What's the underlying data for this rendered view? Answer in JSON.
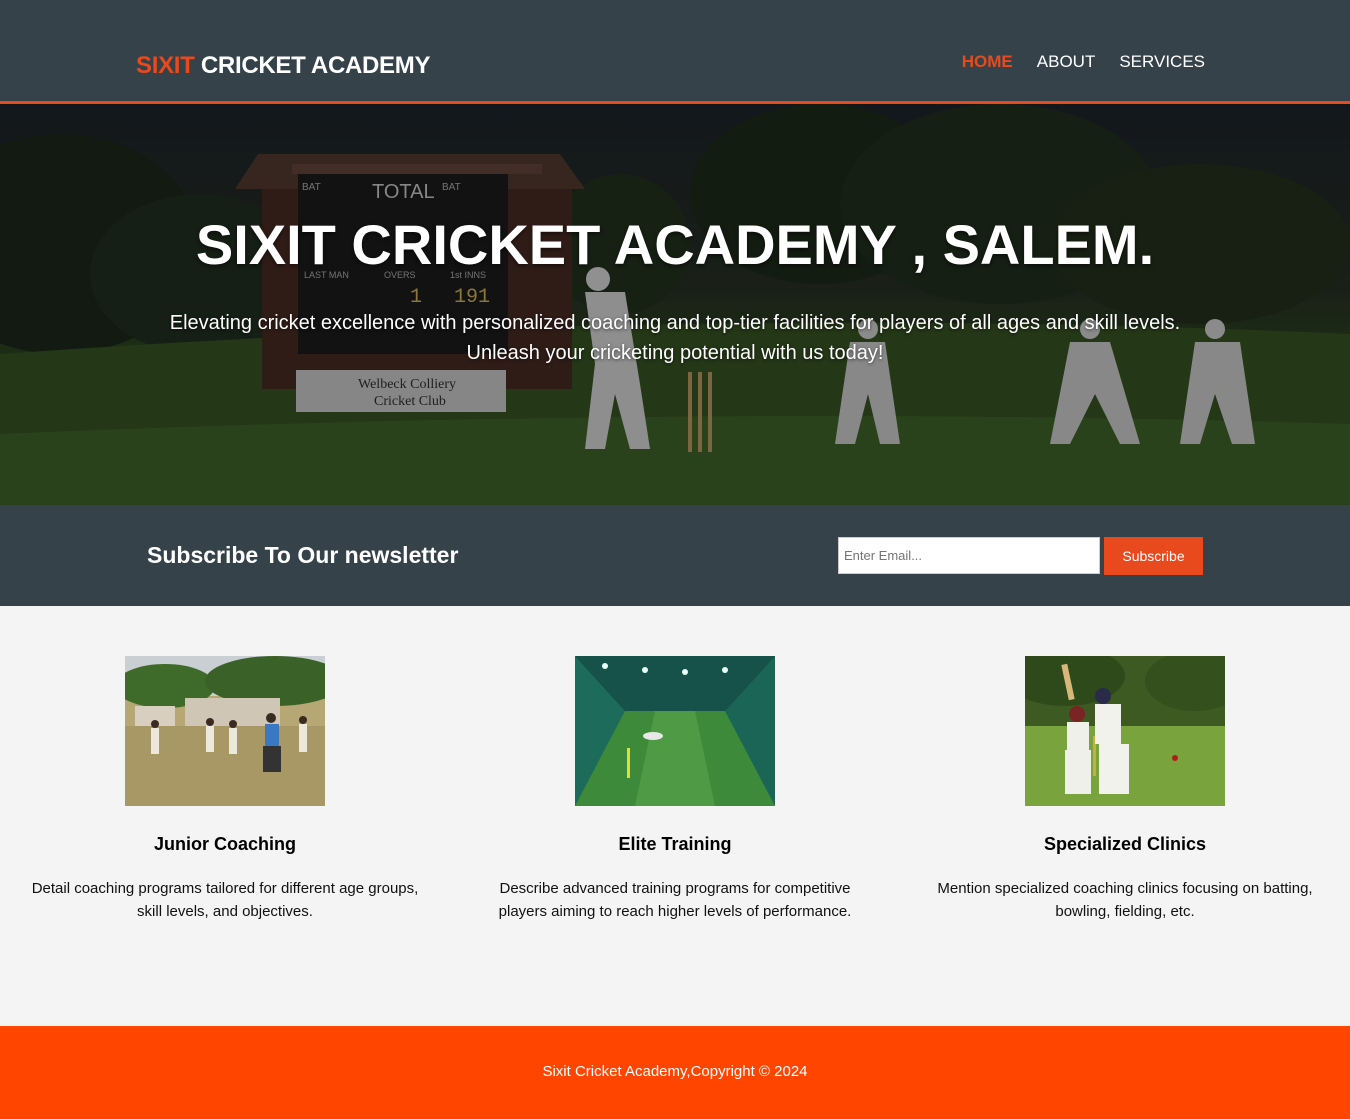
{
  "header": {
    "logo_highlight": "SIXIT",
    "logo_rest": " CRICKET ACADEMY",
    "nav": [
      {
        "label": "HOME",
        "active": true
      },
      {
        "label": "ABOUT",
        "active": false
      },
      {
        "label": "SERVICES",
        "active": false
      }
    ]
  },
  "hero": {
    "title": "SIXIT CRICKET ACADEMY , SALEM.",
    "text": "Elevating cricket excellence with personalized coaching and top-tier facilities for players of all ages and skill levels. Unleash your cricketing potential with us today!",
    "scene": {
      "scoreboard_total": "TOTAL",
      "scoreboard_small": [
        "BAT",
        "BAT",
        "LAST MAN",
        "OVERS",
        "1st INNS"
      ],
      "scoreboard_digits": [
        "1",
        "191"
      ],
      "sign_line1": "Welbeck Colliery",
      "sign_line2": "Cricket Club"
    }
  },
  "newsletter": {
    "title": "Subscribe To Our newsletter",
    "placeholder": "Enter Email...",
    "button": "Subscribe"
  },
  "boxes": [
    {
      "title": "Junior Coaching",
      "text": "Detail coaching programs tailored for different age groups, skill levels, and objectives."
    },
    {
      "title": "Elite Training",
      "text": "Describe advanced training programs for competitive players aiming to reach higher levels of performance."
    },
    {
      "title": "Specialized Clinics",
      "text": "Mention specialized coaching clinics focusing on batting, bowling, fielding, etc."
    }
  ],
  "footer": {
    "text": "Sixit Cricket Academy,Copyright © 2024"
  },
  "colors": {
    "header_bg": "#35424a",
    "accent": "#e8491d",
    "footer_bg": "#ff4500",
    "page_bg": "#f4f4f4"
  }
}
